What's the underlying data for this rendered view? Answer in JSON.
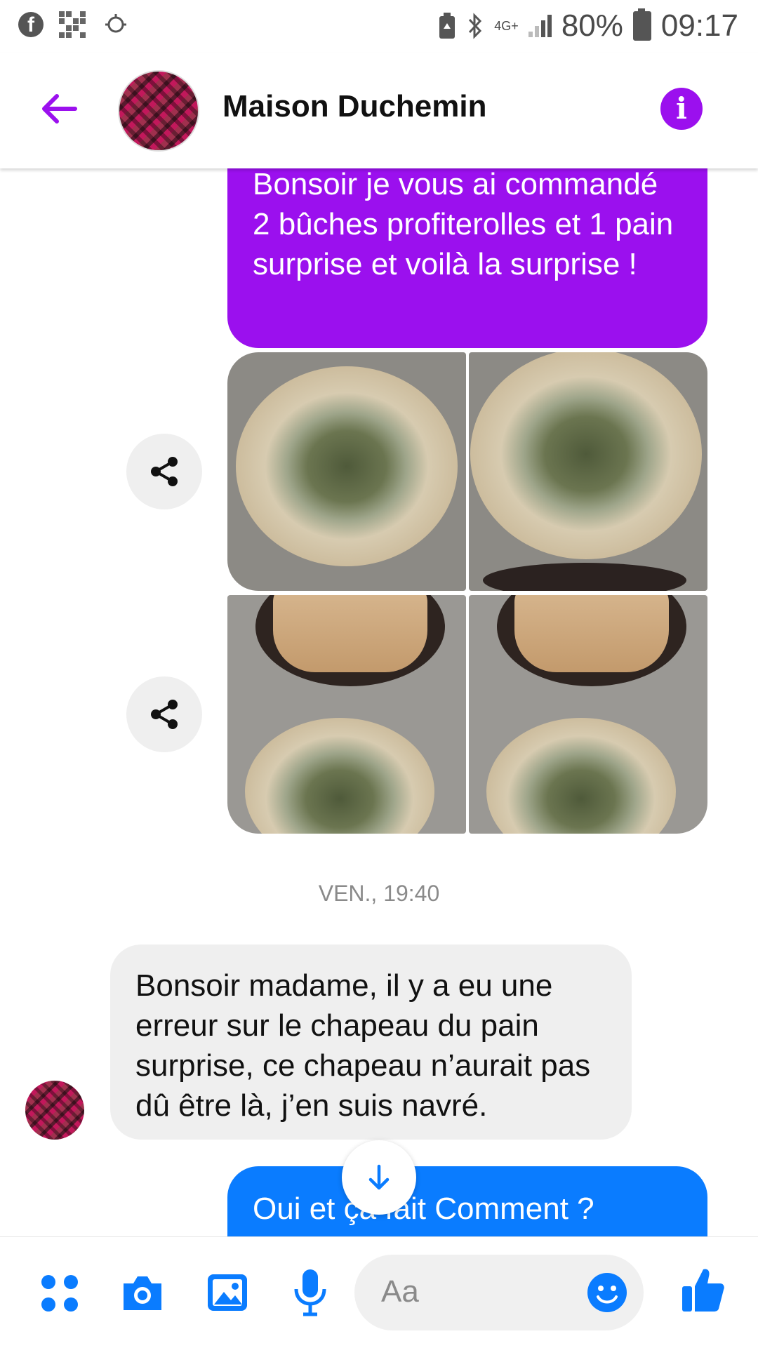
{
  "status_bar": {
    "left_icons": [
      "facebook-icon",
      "qr-code-icon",
      "sync-cloud-icon"
    ],
    "network_label": "4G+",
    "battery": "80%",
    "time": "09:17"
  },
  "header": {
    "title": "Maison Duchemin",
    "back_icon": "back-arrow-icon",
    "info_icon": "info-icon"
  },
  "colors": {
    "accent_purple": "#9b10ee",
    "accent_blue": "#0a7cff",
    "incoming_bg": "#efefef"
  },
  "messages": {
    "outgoing_1": "Bonsoir je vous ai commandé 2 bûches profiterolles et 1 pain surprise et voilà la surprise !",
    "timestamp": "VEN., 19:40",
    "incoming_1": "Bonsoir madame, il y a eu une erreur sur le chapeau du pain surprise, ce chapeau n’aurait pas dû être là, j’en suis navré.",
    "outgoing_2": "Oui et ça fait Comment ?"
  },
  "composer": {
    "placeholder": "Aa",
    "icons": [
      "apps-icon",
      "camera-icon",
      "gallery-icon",
      "microphone-icon",
      "emoji-icon",
      "like-icon"
    ]
  }
}
